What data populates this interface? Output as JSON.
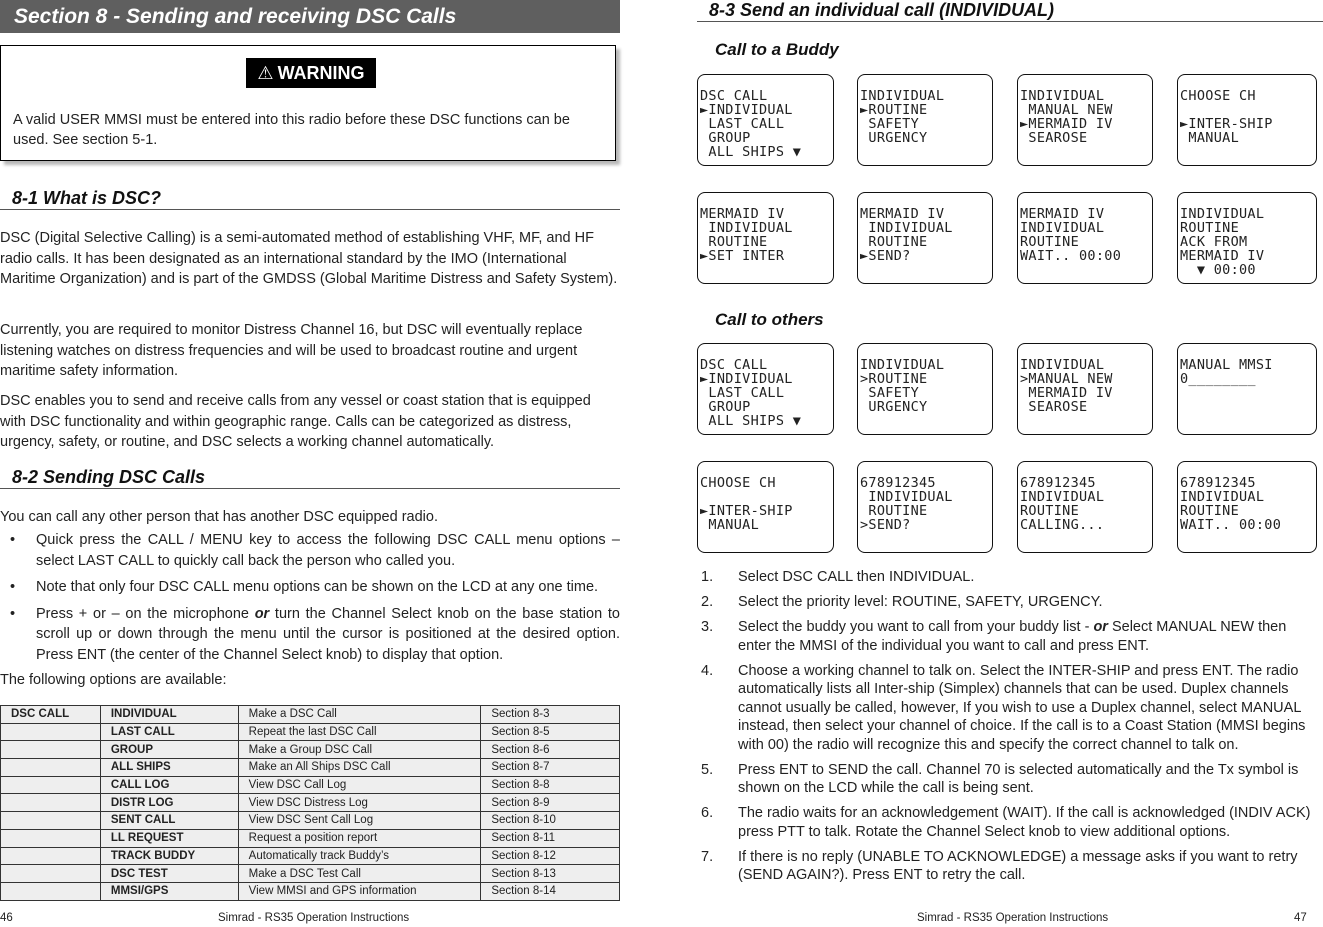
{
  "left_page": {
    "section_title": "Section 8 - Sending and receiving DSC Calls",
    "warning": {
      "icon": "warning-triangle-icon",
      "icon_glyph": "⚠",
      "label": "WARNING",
      "text": "A valid USER MMSI must be entered into this radio before these DSC functions can be used. See section 5-1."
    },
    "sec81": {
      "heading": "8-1 What is DSC?",
      "paragraphs": [
        "DSC (Digital Selective Calling) is a semi-automated method of establishing VHF, MF, and HF radio calls. It has been designated as an international standard by the IMO (International Maritime Organization) and is part of the GMDSS (Global Maritime Distress and Safety System).",
        "Currently, you are required to monitor Distress Channel 16, but DSC will eventually replace listening watches on distress frequencies and will be used to broadcast routine and urgent maritime safety information.",
        "DSC enables you to send and receive calls from any vessel or coast station that is equipped with DSC functionality and within geographic range. Calls can be categorized as distress, urgency, safety, or routine, and DSC selects a working channel automatically."
      ]
    },
    "sec82": {
      "heading": "8-2 Sending DSC Calls",
      "intro": "You can call any other person that has another DSC equipped radio.",
      "bullet_glyph": "•",
      "bullets": [
        {
          "text": "Quick press the CALL / MENU key to access the following DSC CALL menu options – select LAST CALL to quickly call back the person who called you."
        },
        {
          "text": "Note that only four DSC CALL menu options can be shown on the LCD at any one time."
        },
        {
          "pre": "Press + or – on the microphone ",
          "emph": "or",
          "post": " turn the Channel Select knob on the base station to scroll up or down through the menu until the cursor is positioned at the desired option. Press ENT (the center of the Channel Select knob) to display that option."
        }
      ],
      "options_intro": "The following options are available:",
      "table": {
        "rows": [
          [
            "DSC CALL",
            "INDIVIDUAL",
            "Make a DSC Call",
            "Section 8-3"
          ],
          [
            "",
            "LAST CALL",
            "Repeat the last DSC Call",
            "Section 8-5"
          ],
          [
            "",
            "GROUP",
            "Make a Group DSC Call",
            "Section 8-6"
          ],
          [
            "",
            "ALL SHIPS",
            "Make an All Ships DSC Call",
            "Section 8-7"
          ],
          [
            "",
            "CALL LOG",
            "View DSC Call Log",
            "Section 8-8"
          ],
          [
            "",
            "DISTR LOG",
            "View DSC Distress Log",
            "Section 8-9"
          ],
          [
            "",
            "SENT CALL",
            "View DSC Sent Call Log",
            "Section 8-10"
          ],
          [
            "",
            "LL REQUEST",
            "Request a position report",
            "Section 8-11"
          ],
          [
            "",
            "TRACK BUDDY",
            "Automatically track Buddy’s",
            "Section 8-12"
          ],
          [
            "",
            "DSC TEST",
            "Make a DSC Test Call",
            "Section 8-13"
          ],
          [
            "",
            "MMSI/GPS",
            "View MMSI and GPS information",
            "Section 8-14"
          ]
        ]
      }
    },
    "footer": {
      "page_number": "46",
      "title": "Simrad - RS35 Operation Instructions"
    }
  },
  "right_page": {
    "heading": "8-3 Send an individual call (INDIVIDUAL)",
    "buddy": {
      "heading": "Call to a Buddy",
      "screens": [
        [
          "DSC CALL",
          "►INDIVIDUAL",
          " LAST CALL",
          " GROUP",
          " ALL SHIPS ▼"
        ],
        [
          "INDIVIDUAL",
          "►ROUTINE",
          " SAFETY",
          " URGENCY"
        ],
        [
          "INDIVIDUAL",
          " MANUAL NEW",
          "►MERMAID IV",
          " SEAROSE"
        ],
        [
          "CHOOSE CH",
          "",
          "►INTER-SHIP",
          " MANUAL"
        ],
        [
          "MERMAID IV",
          " INDIVIDUAL",
          " ROUTINE",
          "►SET INTER"
        ],
        [
          "MERMAID IV",
          " INDIVIDUAL",
          " ROUTINE",
          "►SEND?"
        ],
        [
          "MERMAID IV",
          "INDIVIDUAL",
          "ROUTINE",
          "WAIT.. 00:00"
        ],
        [
          "INDIVIDUAL",
          "ROUTINE",
          "ACK FROM",
          "MERMAID IV",
          "  ▼ 00:00"
        ]
      ]
    },
    "others": {
      "heading": "Call to others",
      "screens": [
        [
          "DSC CALL",
          "►INDIVIDUAL",
          " LAST CALL",
          " GROUP",
          " ALL SHIPS ▼"
        ],
        [
          "INDIVIDUAL",
          ">ROUTINE",
          " SAFETY",
          " URGENCY"
        ],
        [
          "INDIVIDUAL",
          ">MANUAL NEW",
          " MERMAID IV",
          " SEAROSE"
        ],
        [
          "MANUAL MMSI",
          "0________"
        ],
        [
          "CHOOSE CH",
          "",
          "►INTER-SHIP",
          " MANUAL"
        ],
        [
          "678912345",
          " INDIVIDUAL",
          " ROUTINE",
          ">SEND?"
        ],
        [
          "678912345",
          "INDIVIDUAL",
          "ROUTINE",
          "CALLING..."
        ],
        [
          "678912345",
          "INDIVIDUAL",
          "ROUTINE",
          "WAIT.. 00:00"
        ]
      ]
    },
    "steps": [
      {
        "num": "1.",
        "text": "Select DSC CALL then INDIVIDUAL."
      },
      {
        "num": "2.",
        "text": "Select the priority level: ROUTINE, SAFETY, URGENCY."
      },
      {
        "num": "3.",
        "pre": "Select the buddy you want to call from your buddy list - ",
        "emph": "or",
        "post": " Select MANUAL NEW then enter the MMSI of the individual you want to call and press ENT."
      },
      {
        "num": "4.",
        "text": "Choose a working channel to talk on. Select the INTER-SHIP and press ENT. The radio automatically lists all Inter-ship (Simplex) channels that can be used. Duplex channels cannot usually be called, however, If you wish to use a Duplex channel, select MANUAL instead, then select your channel of choice. If the call is to a Coast Station (MMSI begins with 00) the radio will recognize this and specify the correct channel to talk on."
      },
      {
        "num": "5.",
        "text": "Press ENT to SEND the call. Channel 70 is selected automatically and the Tx symbol is shown on the LCD while the call is being sent."
      },
      {
        "num": "6.",
        "text": "The radio waits for an acknowledgement (WAIT). If the call is acknowledged (INDIV ACK) press PTT to talk. Rotate the Channel Select knob to view additional options."
      },
      {
        "num": "7.",
        "text": "If there is no reply (UNABLE TO ACKNOWLEDGE) a message asks if you want to retry (SEND AGAIN?). Press ENT to retry the call."
      }
    ],
    "footer": {
      "title": "Simrad - RS35 Operation Instructions",
      "page_number": "47"
    }
  }
}
